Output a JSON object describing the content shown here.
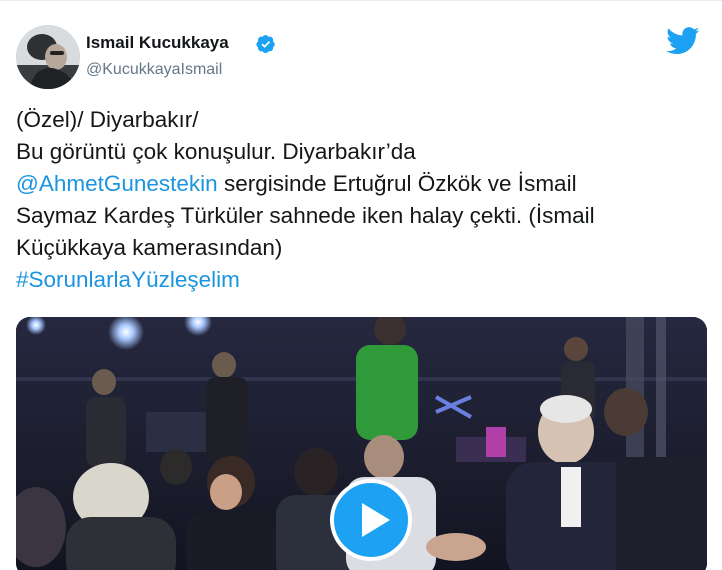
{
  "user": {
    "display_name": "Ismail Kucukkaya",
    "handle": "@KucukkayaIsmail",
    "verified": true,
    "avatar_icon": "profile-photo"
  },
  "brand": {
    "logo_icon": "twitter-bird-icon",
    "color": "#1da1f2"
  },
  "tweet": {
    "line1": "(Özel)/ Diyarbakır/",
    "line2": "Bu görüntü çok konuşulur. Diyarbakır’da",
    "mention": "@AhmetGunestekin",
    "line3_rest": " sergisinde Ertuğrul Özkök ve İsmail",
    "line4": "Saymaz Kardeş Türküler sahnede iken halay çekti. (İsmail",
    "line5": "Küçükkaya kamerasından)",
    "hashtag": "#SorunlarlaYüzleşelim"
  },
  "media": {
    "type": "video",
    "play_icon": "play-icon"
  },
  "colors": {
    "link": "#1b95e0",
    "text": "#14171a",
    "secondary": "#657786"
  }
}
